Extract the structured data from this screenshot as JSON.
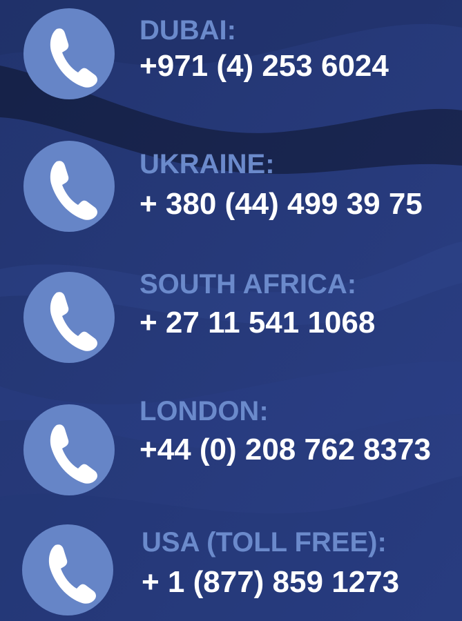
{
  "theme": {
    "background": "#26397a",
    "icon_circle": "#6685c7",
    "label_color": "#6b8acb",
    "number_color": "#ffffff"
  },
  "contacts": [
    {
      "city": "DUBAI:",
      "phone": "+971 (4) 253 6024",
      "icon": "phone-icon"
    },
    {
      "city": "UKRAINE:",
      "phone": "+ 380 (44) 499 39 75",
      "icon": "phone-icon"
    },
    {
      "city": "SOUTH AFRICA:",
      "phone": "+ 27 11 541 1068",
      "icon": "phone-icon"
    },
    {
      "city": "LONDON:",
      "phone": "+44 (0) 208 762 8373",
      "icon": "phone-icon"
    },
    {
      "city": "USA (TOLL FREE):",
      "phone": "+ 1 (877) 859 1273",
      "icon": "phone-icon"
    }
  ]
}
